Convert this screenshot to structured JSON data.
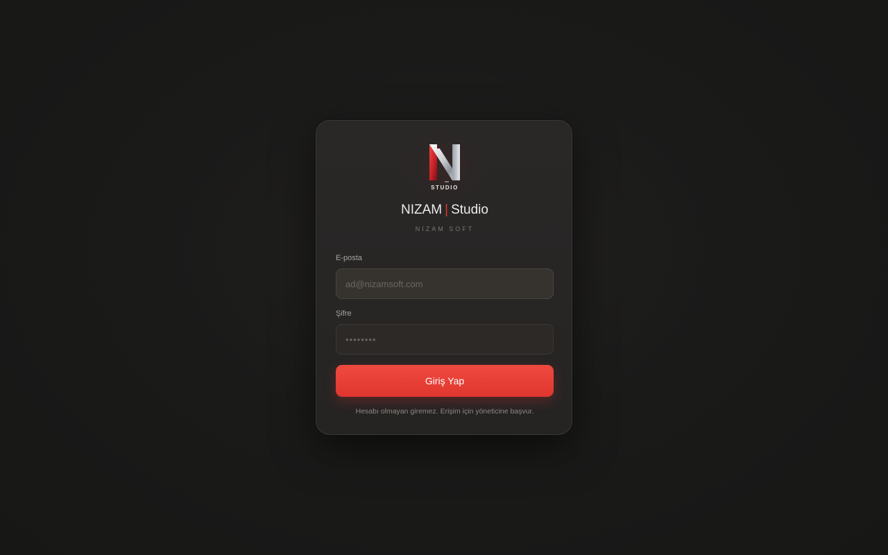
{
  "logo": {
    "letter": "N",
    "subtitle": "STUDIO",
    "icon": "n-studio-logo-icon"
  },
  "brand": {
    "primary": "NIZAM",
    "separator": "|",
    "secondary": "Studio"
  },
  "company": "NİZAM SOFT",
  "form": {
    "email_label": "E-posta",
    "email_placeholder": "ad@nizamsoft.com",
    "email_value": "",
    "password_label": "Şifre",
    "password_placeholder": "••••••••",
    "password_value": "",
    "submit_label": "Giriş Yap"
  },
  "note": "Hesabı olmayan giremez. Erişim için yöneticine başvur.",
  "colors": {
    "accent": "#e0342f",
    "background": "#1a1a19",
    "card": "#272524"
  }
}
